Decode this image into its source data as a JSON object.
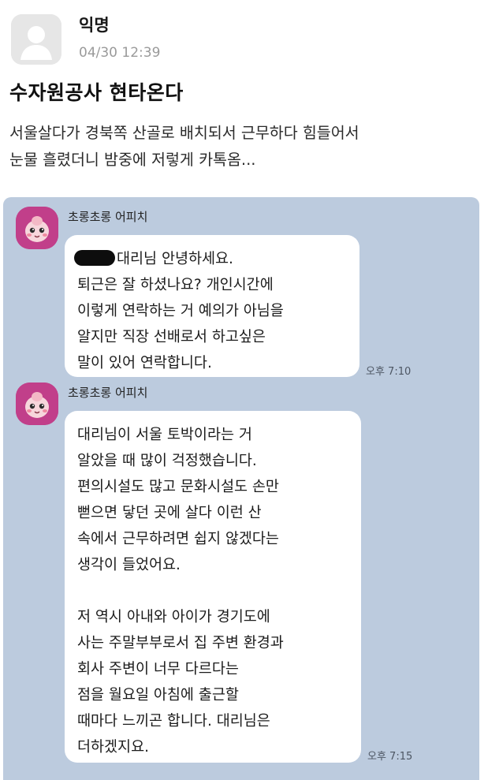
{
  "post": {
    "author": "익명",
    "time": "04/30 12:39",
    "title": "수자원공사 현타온다",
    "body_lines": [
      "서울살다가 경북쪽 산골로 배치되서 근무하다 힘들어서",
      "눈물 흘렸더니 밤중에 저렇게 카톡옴..."
    ]
  },
  "chat": {
    "messages": [
      {
        "sender": "초롱초롱 어피치",
        "first_line_after_mask": "대리님 안녕하세요.",
        "lines": [
          "퇴근은 잘 하셨나요? 개인시간에",
          "이렇게 연락하는 거 예의가 아님을",
          "알지만 직장 선배로서 하고싶은",
          "말이 있어 연락합니다."
        ],
        "time": "오후 7:10"
      },
      {
        "sender": "초롱초롱 어피치",
        "para1": [
          "대리님이 서울 토박이라는 거",
          "알았을 때 많이 걱정했습니다.",
          "편의시설도 많고 문화시설도 손만",
          "뻗으면 닿던 곳에 살다 이런 산",
          "속에서 근무하려면 쉽지 않겠다는",
          "생각이 들었어요."
        ],
        "para2": [
          "저 역시 아내와 아이가 경기도에",
          "사는 주말부부로서 집 주변 환경과",
          "회사 주변이 너무 다르다는",
          "점을 월요일 아침에 출근할",
          "때마다 느끼곤 합니다. 대리님은",
          "더하겠지요."
        ],
        "time": "오후 7:15"
      }
    ]
  },
  "colors": {
    "chat_background": "#bccbde",
    "avatar_pink": "#c13f8a",
    "bubble": "#ffffff"
  }
}
